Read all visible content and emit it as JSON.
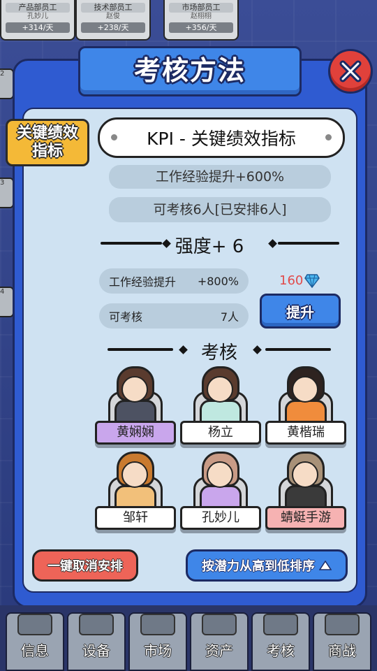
{
  "top_cards": [
    {
      "dept": "产品部员工",
      "name": "孔妙儿",
      "rate": "+314/天"
    },
    {
      "dept": "技术部员工",
      "name": "赵俊",
      "rate": "+238/天"
    },
    {
      "dept": "市场部员工",
      "name": "赵栩栩",
      "rate": "+356/天"
    }
  ],
  "side_desks": [
    "2",
    "3",
    "4"
  ],
  "dialog": {
    "title": "考核方法",
    "badge": "关键绩效\n指标",
    "method_name": "KPI - 关键绩效指标",
    "effect_exp": "工作经验提升+600%",
    "effect_capacity": "可考核6人[已安排6人]",
    "strength_title": "强度+ 6",
    "next_exp_label": "工作经验提升",
    "next_exp_value": "+800%",
    "next_cap_label": "可考核",
    "next_cap_value": "7人",
    "upgrade_cost": "160",
    "upgrade_label": "提升",
    "assess_title": "考核",
    "cancel_label": "一键取消安排",
    "sort_label": "按潜力从高到低排序"
  },
  "employees": [
    {
      "name": "黄娴娴",
      "plate": "#c9a6ec",
      "hair": "#5a3b2e",
      "body": "#4d5262"
    },
    {
      "name": "杨立",
      "plate": "#ffffff",
      "hair": "#5a3b2e",
      "body": "#bfe8e0"
    },
    {
      "name": "黄楷瑞",
      "plate": "#ffffff",
      "hair": "#2e2320",
      "body": "#f08c3c"
    },
    {
      "name": "邹轩",
      "plate": "#ffffff",
      "hair": "#c97a2f",
      "body": "#f2c07a"
    },
    {
      "name": "孔妙儿",
      "plate": "#ffffff",
      "hair": "#c99b86",
      "body": "#c9a6ec"
    },
    {
      "name": "蜻蜓手游",
      "plate": "#f6b2b2",
      "hair": "#a89178",
      "body": "#3a3a3a"
    }
  ],
  "nav": [
    {
      "label": "信息",
      "icon": "info-icon"
    },
    {
      "label": "设备",
      "icon": "equipment-icon"
    },
    {
      "label": "市场",
      "icon": "market-icon"
    },
    {
      "label": "资产",
      "icon": "assets-icon"
    },
    {
      "label": "考核",
      "icon": "assessment-icon"
    },
    {
      "label": "商战",
      "icon": "business-war-icon"
    }
  ],
  "colors": {
    "panel": "#2f5bd1",
    "inner": "#cfe2f2",
    "accent": "#3f86e8",
    "cost": "#e14b4b",
    "gem": "#4ab6f0"
  }
}
